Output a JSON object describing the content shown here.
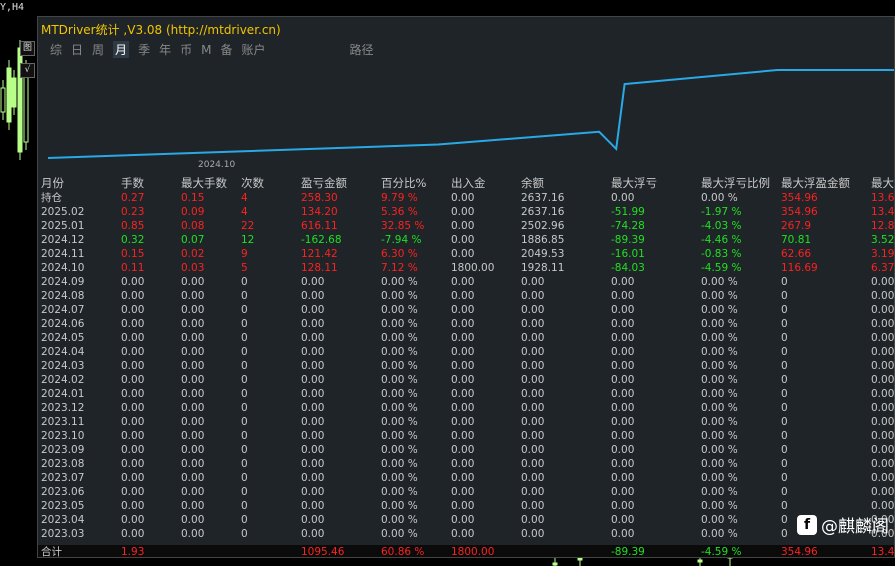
{
  "corner_label": "Y,H4",
  "side_tools": [
    "图",
    "√"
  ],
  "panel": {
    "title": "MTDriver统计 ,V3.08 (http://mtdriver.cn)",
    "tabs": [
      {
        "label": "综"
      },
      {
        "label": "日"
      },
      {
        "label": "周"
      },
      {
        "label": "月",
        "selected": true
      },
      {
        "label": "季"
      },
      {
        "label": "年"
      },
      {
        "label": "币"
      },
      {
        "label": "M"
      },
      {
        "label": "备"
      },
      {
        "label": "账户"
      },
      {
        "label": "路径"
      }
    ],
    "chart_date": "2024.10"
  },
  "chart_data": {
    "type": "line",
    "x": [
      "2024.09",
      "2024.10",
      "2024.11",
      "2024.12",
      "2025.01",
      "2025.02",
      "持仓"
    ],
    "series": [
      {
        "values": [
          1800.0,
          1928.11,
          2049.53,
          1886.85,
          2502.96,
          2637.16,
          2637.16
        ]
      }
    ],
    "color": "#29a9e6"
  },
  "table": {
    "headers": [
      "月份",
      "手数",
      "最大手数",
      "次数",
      "盈亏金额",
      "百分比%",
      "出入金",
      "余额",
      "最大浮亏",
      "最大浮亏比例",
      "最大浮盈金额",
      "最大"
    ],
    "rows": [
      {
        "cells": [
          "持仓",
          "0.27",
          "0.15",
          "4",
          "258.30",
          "9.79 %",
          "0.00",
          "2637.16",
          "0.00",
          "0.00 %",
          "354.96",
          "13.6"
        ],
        "color": "red"
      },
      {
        "cells": [
          "2025.02",
          "0.23",
          "0.09",
          "4",
          "134.20",
          "5.36 %",
          "0.00",
          "2637.16",
          "-51.99",
          "-1.97 %",
          "354.96",
          "13.4"
        ],
        "color": "red"
      },
      {
        "cells": [
          "2025.01",
          "0.85",
          "0.08",
          "22",
          "616.11",
          "32.85 %",
          "0.00",
          "2502.96",
          "-74.28",
          "-4.03 %",
          "267.9",
          "12.8"
        ],
        "color": "red"
      },
      {
        "cells": [
          "2024.12",
          "0.32",
          "0.07",
          "12",
          "-162.68",
          "-7.94 %",
          "0.00",
          "1886.85",
          "-89.39",
          "-4.46 %",
          "70.81",
          "3.52"
        ],
        "color": "green"
      },
      {
        "cells": [
          "2024.11",
          "0.15",
          "0.02",
          "9",
          "121.42",
          "6.30 %",
          "0.00",
          "2049.53",
          "-16.01",
          "-0.83 %",
          "62.66",
          "3.19"
        ],
        "color": "red"
      },
      {
        "cells": [
          "2024.10",
          "0.11",
          "0.03",
          "5",
          "128.11",
          "7.12 %",
          "1800.00",
          "1928.11",
          "-84.03",
          "-4.59 %",
          "116.69",
          "6.37"
        ],
        "color": "red"
      },
      {
        "cells": [
          "2024.09",
          "0.00",
          "0.00",
          "0",
          "0.00",
          "0.00 %",
          "0.00",
          "0.00",
          "0.00",
          "0.00 %",
          "0",
          "0.00"
        ],
        "color": "grey"
      },
      {
        "cells": [
          "2024.08",
          "0.00",
          "0.00",
          "0",
          "0.00",
          "0.00 %",
          "0.00",
          "0.00",
          "0.00",
          "0.00 %",
          "0",
          "0.00"
        ],
        "color": "grey"
      },
      {
        "cells": [
          "2024.07",
          "0.00",
          "0.00",
          "0",
          "0.00",
          "0.00 %",
          "0.00",
          "0.00",
          "0.00",
          "0.00 %",
          "0",
          "0.00"
        ],
        "color": "grey"
      },
      {
        "cells": [
          "2024.06",
          "0.00",
          "0.00",
          "0",
          "0.00",
          "0.00 %",
          "0.00",
          "0.00",
          "0.00",
          "0.00 %",
          "0",
          "0.00"
        ],
        "color": "grey"
      },
      {
        "cells": [
          "2024.05",
          "0.00",
          "0.00",
          "0",
          "0.00",
          "0.00 %",
          "0.00",
          "0.00",
          "0.00",
          "0.00 %",
          "0",
          "0.00"
        ],
        "color": "grey"
      },
      {
        "cells": [
          "2024.04",
          "0.00",
          "0.00",
          "0",
          "0.00",
          "0.00 %",
          "0.00",
          "0.00",
          "0.00",
          "0.00 %",
          "0",
          "0.00"
        ],
        "color": "grey"
      },
      {
        "cells": [
          "2024.03",
          "0.00",
          "0.00",
          "0",
          "0.00",
          "0.00 %",
          "0.00",
          "0.00",
          "0.00",
          "0.00 %",
          "0",
          "0.00"
        ],
        "color": "grey"
      },
      {
        "cells": [
          "2024.02",
          "0.00",
          "0.00",
          "0",
          "0.00",
          "0.00 %",
          "0.00",
          "0.00",
          "0.00",
          "0.00 %",
          "0",
          "0.00"
        ],
        "color": "grey"
      },
      {
        "cells": [
          "2024.01",
          "0.00",
          "0.00",
          "0",
          "0.00",
          "0.00 %",
          "0.00",
          "0.00",
          "0.00",
          "0.00 %",
          "0",
          "0.00"
        ],
        "color": "grey"
      },
      {
        "cells": [
          "2023.12",
          "0.00",
          "0.00",
          "0",
          "0.00",
          "0.00 %",
          "0.00",
          "0.00",
          "0.00",
          "0.00 %",
          "0",
          "0.00"
        ],
        "color": "grey"
      },
      {
        "cells": [
          "2023.11",
          "0.00",
          "0.00",
          "0",
          "0.00",
          "0.00 %",
          "0.00",
          "0.00",
          "0.00",
          "0.00 %",
          "0",
          "0.00"
        ],
        "color": "grey"
      },
      {
        "cells": [
          "2023.10",
          "0.00",
          "0.00",
          "0",
          "0.00",
          "0.00 %",
          "0.00",
          "0.00",
          "0.00",
          "0.00 %",
          "0",
          "0.00"
        ],
        "color": "grey"
      },
      {
        "cells": [
          "2023.09",
          "0.00",
          "0.00",
          "0",
          "0.00",
          "0.00 %",
          "0.00",
          "0.00",
          "0.00",
          "0.00 %",
          "0",
          "0.00"
        ],
        "color": "grey"
      },
      {
        "cells": [
          "2023.08",
          "0.00",
          "0.00",
          "0",
          "0.00",
          "0.00 %",
          "0.00",
          "0.00",
          "0.00",
          "0.00 %",
          "0",
          "0.00"
        ],
        "color": "grey"
      },
      {
        "cells": [
          "2023.07",
          "0.00",
          "0.00",
          "0",
          "0.00",
          "0.00 %",
          "0.00",
          "0.00",
          "0.00",
          "0.00 %",
          "0",
          "0.00"
        ],
        "color": "grey"
      },
      {
        "cells": [
          "2023.06",
          "0.00",
          "0.00",
          "0",
          "0.00",
          "0.00 %",
          "0.00",
          "0.00",
          "0.00",
          "0.00 %",
          "0",
          "0.00"
        ],
        "color": "grey"
      },
      {
        "cells": [
          "2023.05",
          "0.00",
          "0.00",
          "0",
          "0.00",
          "0.00 %",
          "0.00",
          "0.00",
          "0.00",
          "0.00 %",
          "0",
          "0.00"
        ],
        "color": "grey"
      },
      {
        "cells": [
          "2023.04",
          "0.00",
          "0.00",
          "0",
          "0.00",
          "0.00 %",
          "0.00",
          "0.00",
          "0.00",
          "0.00 %",
          "0",
          "0.00"
        ],
        "color": "grey"
      },
      {
        "cells": [
          "2023.03",
          "0.00",
          "0.00",
          "0",
          "0.00",
          "0.00 %",
          "0.00",
          "0.00",
          "0.00",
          "0.00 %",
          "0",
          "0.00"
        ],
        "color": "grey"
      }
    ],
    "total": {
      "cells": [
        "合计",
        "1.93",
        "",
        "",
        "1095.46",
        "60.86 %",
        "1800.00",
        "",
        "-89.39",
        "-4.59 %",
        "354.96",
        "13.4"
      ],
      "colors": [
        "grey",
        "red",
        "red",
        "red",
        "red",
        "red",
        "red",
        "red",
        "green",
        "green",
        "red",
        "red"
      ]
    }
  },
  "watermark": {
    "text": "@麒麟阁",
    "logo_glyph": "f"
  }
}
